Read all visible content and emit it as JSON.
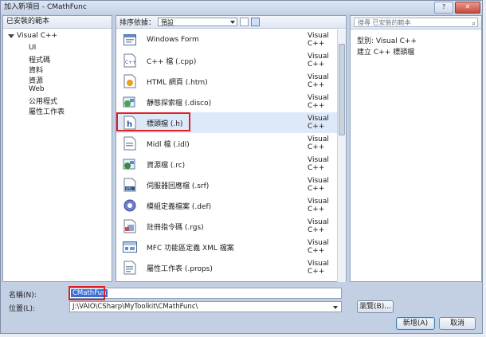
{
  "window": {
    "title": "加入新項目 - CMathFunc"
  },
  "left": {
    "header": "已安裝的範本",
    "root": "Visual C++",
    "items": [
      "UI",
      "程式碼",
      "資料",
      "資源",
      "Web",
      "公用程式",
      "屬性工作表"
    ]
  },
  "toolbar": {
    "sort_label": "排序依據：",
    "sort_value": "預設"
  },
  "templates": [
    {
      "name": "Windows Form",
      "lang": "Visual C++",
      "icon": "windows-form-icon",
      "selected": false
    },
    {
      "name": "C++ 檔 (.cpp)",
      "lang": "Visual C++",
      "icon": "cpp-file-icon",
      "selected": false
    },
    {
      "name": "HTML 網頁 (.htm)",
      "lang": "Visual C++",
      "icon": "html-file-icon",
      "selected": false
    },
    {
      "name": "靜態探索檔 (.disco)",
      "lang": "Visual C++",
      "icon": "disco-file-icon",
      "selected": false
    },
    {
      "name": "標頭檔 (.h)",
      "lang": "Visual C++",
      "icon": "header-file-icon",
      "selected": true
    },
    {
      "name": "Midl 檔 (.idl)",
      "lang": "Visual C++",
      "icon": "midl-file-icon",
      "selected": false
    },
    {
      "name": "資源檔 (.rc)",
      "lang": "Visual C++",
      "icon": "resource-file-icon",
      "selected": false
    },
    {
      "name": "伺服器回應檔 (.srf)",
      "lang": "Visual C++",
      "icon": "atl-srf-file-icon",
      "selected": false
    },
    {
      "name": "模組定義檔案 (.def)",
      "lang": "Visual C++",
      "icon": "def-file-icon",
      "selected": false
    },
    {
      "name": "註冊指令碼 (.rgs)",
      "lang": "Visual C++",
      "icon": "rgs-file-icon",
      "selected": false
    },
    {
      "name": "MFC 功能區定義 XML 檔案",
      "lang": "Visual C++",
      "icon": "mfc-ribbon-icon",
      "selected": false
    },
    {
      "name": "屬性工作表 (.props)",
      "lang": "Visual C++",
      "icon": "props-file-icon",
      "selected": false
    }
  ],
  "search": {
    "placeholder": "搜尋 已安裝的範本"
  },
  "description": {
    "type": "型別:  Visual C++",
    "text": "建立 C++ 標頭檔"
  },
  "form": {
    "name_label": "名稱(N):",
    "name_value": "CMathFun",
    "location_label": "位置(L):",
    "location_value": "J:\\VAIO\\CSharp\\MyToolkit\\CMathFunc\\",
    "browse_label": "瀏覽(B)...",
    "add_label": "新增(A)",
    "cancel_label": "取消"
  },
  "colors": {
    "highlight_red": "#e01f26",
    "selection_blue": "#3a6fd8"
  }
}
